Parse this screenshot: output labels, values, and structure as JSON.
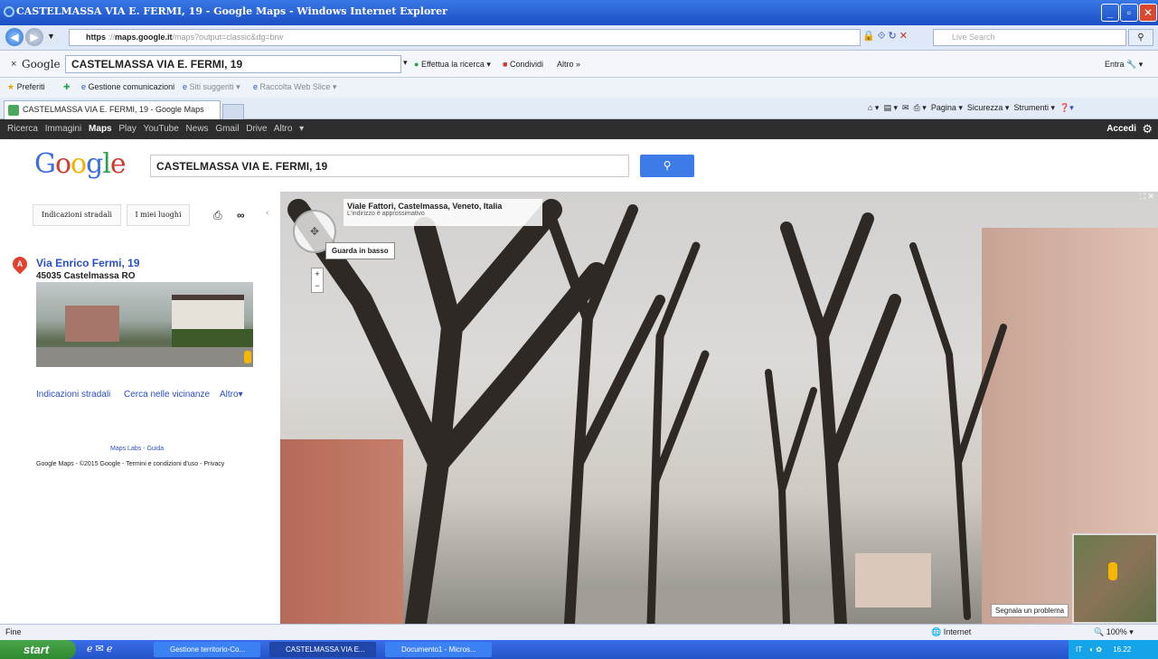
{
  "window": {
    "title": "CASTELMASSA VIA E. FERMI, 19 - Google Maps - Windows Internet Explorer"
  },
  "address_bar": {
    "url_prefix": "https",
    "url_domain": "maps.google.it",
    "url_rest": "/maps?output=classic&dg=brw",
    "search_placeholder": "Live Search"
  },
  "google_toolbar": {
    "logo": "Google",
    "search_value": "CASTELMASSA VIA E. FERMI, 19",
    "search_btn": "Effettua la ricerca",
    "share": "Condividi",
    "more": "Altro »",
    "signin": "Entra"
  },
  "favorites_bar": {
    "favorites": "Preferiti",
    "item1": "Gestione comunicazioni",
    "item2": "Siti suggeriti",
    "item3": "Raccolta Web Slice"
  },
  "tab": {
    "label": "CASTELMASSA VIA E. FERMI, 19 - Google Maps"
  },
  "command_bar": {
    "page": "Pagina",
    "security": "Sicurezza",
    "tools": "Strumenti"
  },
  "google_bar": {
    "items": [
      "Ricerca",
      "Immagini",
      "Maps",
      "Play",
      "YouTube",
      "News",
      "Gmail",
      "Drive",
      "Altro"
    ],
    "active": "Maps",
    "accedi": "Accedi"
  },
  "maps_header": {
    "logo": "Google",
    "search_value": "CASTELMASSA VIA E. FERMI, 19",
    "search_button_icon": "search-icon"
  },
  "left_panel": {
    "btn_directions": "Indicazioni stradali",
    "btn_my_places": "I miei luoghi",
    "pin_letter": "A",
    "address_line1": "Via Enrico Fermi, 19",
    "address_line2": "45035 Castelmassa RO",
    "link_directions": "Indicazioni stradali",
    "link_nearby": "Cerca nelle vicinanze",
    "link_more": "Altro",
    "footer_links": "Maps Labs - Guida",
    "footer_copyright": "Google Maps - ©2015 Google - Termini e condizioni d'uso - Privacy"
  },
  "street_view": {
    "location": "Viale Fattori, Castelmassa, Veneto, Italia",
    "note": "L'indirizzo è approssimativo",
    "tooltip": "Guarda in basso",
    "report": "Segnala un problema"
  },
  "status_bar": {
    "left": "Fine",
    "zone": "Internet",
    "zoom": "100%"
  },
  "taskbar": {
    "start": "start",
    "tasks": [
      "Gestione territorio-Co...",
      "CASTELMASSA VIA E...",
      "Documento1 - Micros..."
    ],
    "lang": "IT",
    "time": "16.22"
  }
}
